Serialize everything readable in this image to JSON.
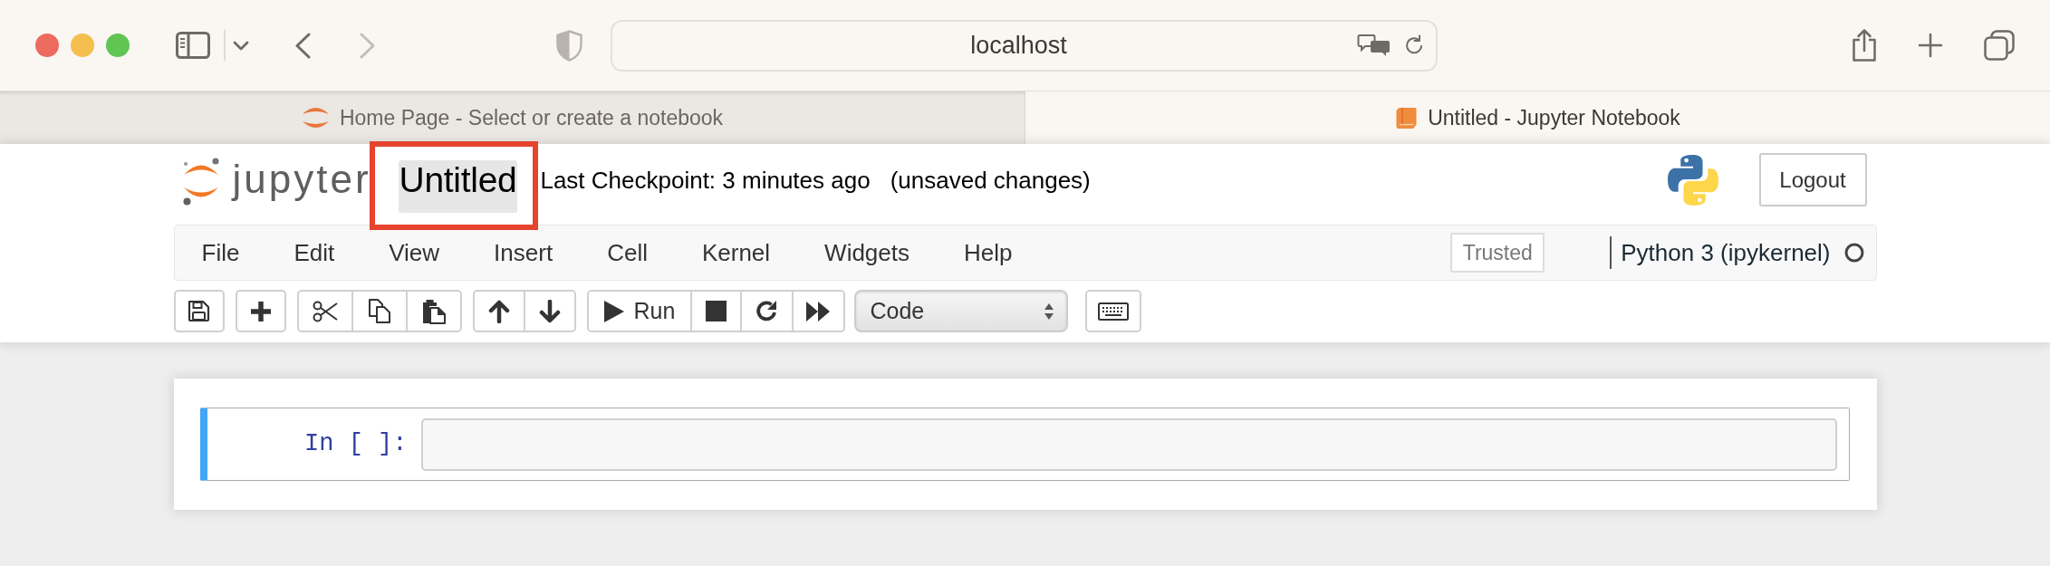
{
  "browser": {
    "window_controls": [
      {
        "color": "#ed6a5e"
      },
      {
        "color": "#f5bf4f"
      },
      {
        "color": "#61c554"
      }
    ],
    "back": {
      "disabled": false
    },
    "forward": {
      "disabled": true
    },
    "address": "localhost",
    "tabs": [
      {
        "kind": "home",
        "title": "Home Page - Select or create a notebook",
        "selected": false
      },
      {
        "kind": "notebook",
        "title": "Untitled - Jupyter Notebook",
        "selected": true
      }
    ]
  },
  "header": {
    "logo_text": "jupyter",
    "notebook_title": {
      "text": "Untitled",
      "highlighted": true
    },
    "checkpoint": "Last Checkpoint: 3 minutes ago",
    "save_status": "(unsaved changes)",
    "logout": "Logout"
  },
  "menubar": {
    "items": [
      "File",
      "Edit",
      "View",
      "Insert",
      "Cell",
      "Kernel",
      "Widgets",
      "Help"
    ],
    "trusted": "Trusted",
    "kernel": {
      "name": "Python 3 (ipykernel)",
      "busy": false
    }
  },
  "toolbar": [
    {
      "kind": "group",
      "buttons": [
        {
          "kind": "save"
        }
      ]
    },
    {
      "kind": "group",
      "buttons": [
        {
          "kind": "insert"
        }
      ]
    },
    {
      "kind": "group",
      "buttons": [
        {
          "kind": "cut"
        },
        {
          "kind": "copy"
        },
        {
          "kind": "paste"
        }
      ]
    },
    {
      "kind": "group",
      "buttons": [
        {
          "kind": "move-up"
        },
        {
          "kind": "move-down"
        }
      ]
    },
    {
      "kind": "group",
      "buttons": [
        {
          "kind": "run",
          "label": "Run"
        },
        {
          "kind": "interrupt"
        },
        {
          "kind": "restart"
        },
        {
          "kind": "run-all"
        }
      ]
    },
    {
      "kind": "select",
      "value": "Code"
    },
    {
      "kind": "group",
      "buttons": [
        {
          "kind": "command-palette"
        }
      ]
    }
  ],
  "cells": [
    {
      "prompt": "In [ ]:",
      "selected": true
    }
  ]
}
